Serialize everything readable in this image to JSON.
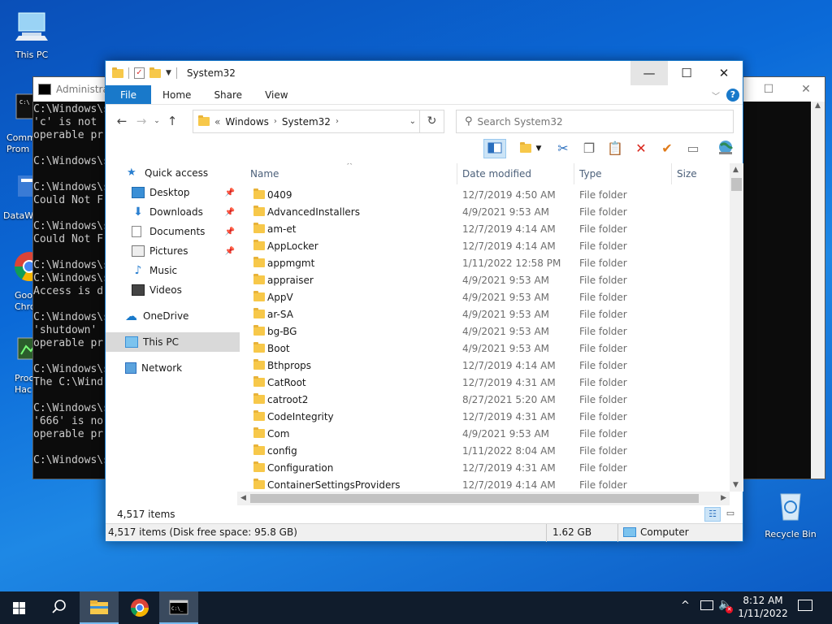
{
  "desktop": {
    "icons": [
      {
        "label": "This PC"
      },
      {
        "label": "Comm Prom"
      },
      {
        "label": "DataW"
      },
      {
        "label": "Goo Chro"
      },
      {
        "label": "Proc Hac"
      },
      {
        "label": "Recycle Bin"
      }
    ]
  },
  "cmd": {
    "title": "Administra",
    "lines": [
      "C:\\Windows\\s",
      "'c' is not",
      "operable pr",
      "",
      "C:\\Windows\\s",
      "",
      "C:\\Windows\\s",
      "Could Not F",
      "",
      "C:\\Windows\\s",
      "Could Not F",
      "",
      "C:\\Windows\\s",
      "C:\\Windows\\s",
      "Access is d",
      "",
      "C:\\Windows\\s",
      "'shutdown'",
      "operable pr",
      "",
      "C:\\Windows\\s",
      "The C:\\Wind",
      "",
      "C:\\Windows\\s",
      "'666' is no",
      "operable pr",
      "",
      "C:\\Windows\\s"
    ]
  },
  "explorer": {
    "title": "System32",
    "ribbon_tabs": [
      "File",
      "Home",
      "Share",
      "View"
    ],
    "help": "?",
    "address": {
      "prefix": "«",
      "segments": [
        "Windows",
        "System32"
      ]
    },
    "search_placeholder": "Search System32",
    "nav": [
      {
        "label": "Quick access",
        "icon": "star-icon"
      },
      {
        "label": "Desktop",
        "icon": "desktop-icon",
        "pinned": true
      },
      {
        "label": "Downloads",
        "icon": "download-icon",
        "pinned": true
      },
      {
        "label": "Documents",
        "icon": "document-icon",
        "pinned": true
      },
      {
        "label": "Pictures",
        "icon": "pictures-icon",
        "pinned": true
      },
      {
        "label": "Music",
        "icon": "music-icon"
      },
      {
        "label": "Videos",
        "icon": "videos-icon"
      },
      {
        "label": "OneDrive",
        "icon": "cloud-icon"
      },
      {
        "label": "This PC",
        "icon": "computer-icon",
        "selected": true
      },
      {
        "label": "Network",
        "icon": "network-icon"
      }
    ],
    "columns": {
      "name": "Name",
      "date": "Date modified",
      "type": "Type",
      "size": "Size"
    },
    "files": [
      {
        "name": "0409",
        "date": "12/7/2019 4:50 AM",
        "type": "File folder"
      },
      {
        "name": "AdvancedInstallers",
        "date": "4/9/2021 9:53 AM",
        "type": "File folder"
      },
      {
        "name": "am-et",
        "date": "12/7/2019 4:14 AM",
        "type": "File folder"
      },
      {
        "name": "AppLocker",
        "date": "12/7/2019 4:14 AM",
        "type": "File folder"
      },
      {
        "name": "appmgmt",
        "date": "1/11/2022 12:58 PM",
        "type": "File folder"
      },
      {
        "name": "appraiser",
        "date": "4/9/2021 9:53 AM",
        "type": "File folder"
      },
      {
        "name": "AppV",
        "date": "4/9/2021 9:53 AM",
        "type": "File folder"
      },
      {
        "name": "ar-SA",
        "date": "4/9/2021 9:53 AM",
        "type": "File folder"
      },
      {
        "name": "bg-BG",
        "date": "4/9/2021 9:53 AM",
        "type": "File folder"
      },
      {
        "name": "Boot",
        "date": "4/9/2021 9:53 AM",
        "type": "File folder"
      },
      {
        "name": "Bthprops",
        "date": "12/7/2019 4:14 AM",
        "type": "File folder"
      },
      {
        "name": "CatRoot",
        "date": "12/7/2019 4:31 AM",
        "type": "File folder"
      },
      {
        "name": "catroot2",
        "date": "8/27/2021 5:20 AM",
        "type": "File folder"
      },
      {
        "name": "CodeIntegrity",
        "date": "12/7/2019 4:31 AM",
        "type": "File folder"
      },
      {
        "name": "Com",
        "date": "4/9/2021 9:53 AM",
        "type": "File folder"
      },
      {
        "name": "config",
        "date": "1/11/2022 8:04 AM",
        "type": "File folder"
      },
      {
        "name": "Configuration",
        "date": "12/7/2019 4:31 AM",
        "type": "File folder"
      },
      {
        "name": "ContainerSettingsProviders",
        "date": "12/7/2019 4:14 AM",
        "type": "File folder"
      }
    ],
    "item_count": "4,517 items",
    "status": {
      "left": "4,517 items (Disk free space: 95.8 GB)",
      "size": "1.62 GB",
      "location": "Computer"
    }
  },
  "taskbar": {
    "time": "8:12 AM",
    "date": "1/11/2022"
  },
  "colors": {
    "accent": "#1979ca",
    "folder": "#f7c84a",
    "taskbar": "#101c2c"
  }
}
